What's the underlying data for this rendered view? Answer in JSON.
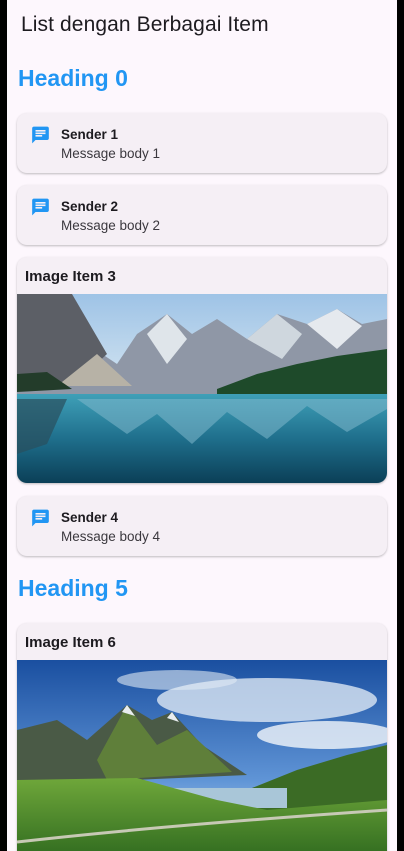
{
  "app": {
    "title": "List dengan Berbagai Item"
  },
  "items": [
    {
      "type": "heading",
      "text": "Heading 0"
    },
    {
      "type": "message",
      "sender": "Sender 1",
      "body": "Message body 1",
      "icon": "message-icon"
    },
    {
      "type": "message",
      "sender": "Sender 2",
      "body": "Message body 2",
      "icon": "message-icon"
    },
    {
      "type": "image",
      "title": "Image Item 3"
    },
    {
      "type": "message",
      "sender": "Sender 4",
      "body": "Message body 4",
      "icon": "message-icon"
    },
    {
      "type": "heading",
      "text": "Heading 5"
    },
    {
      "type": "image",
      "title": "Image Item 6"
    }
  ],
  "colors": {
    "accent": "#2196f3",
    "background": "#fdf7fd",
    "card": "#f5eff5"
  }
}
